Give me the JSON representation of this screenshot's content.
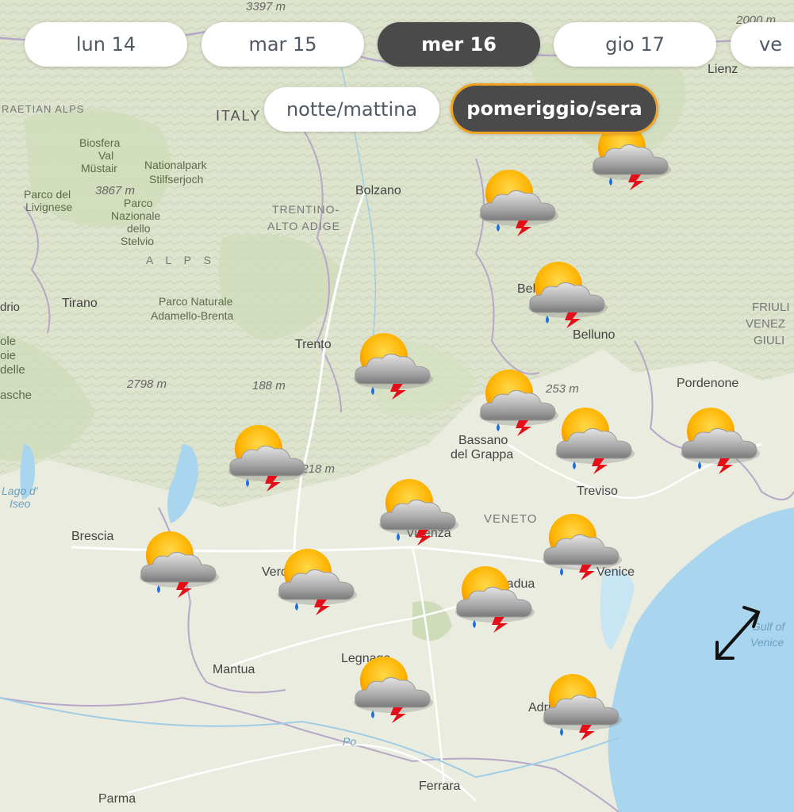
{
  "days": [
    {
      "label": "lun 14",
      "active": false
    },
    {
      "label": "mar 15",
      "active": false
    },
    {
      "label": "mer 16",
      "active": true
    },
    {
      "label": "gio 17",
      "active": false
    },
    {
      "label": "ve",
      "active": false
    }
  ],
  "periods": [
    {
      "label": "notte/mattina",
      "active": false
    },
    {
      "label": "pomeriggio/sera",
      "active": true
    }
  ],
  "map": {
    "places": [
      "Bolzano",
      "TRENTINO-",
      "ALTO ADIGE",
      "Tirano",
      "Trento",
      "Belluno",
      "Pordenone",
      "Bassano",
      "del Grappa",
      "Treviso",
      "VENETO",
      "Vicenza",
      "Brescia",
      "Venice",
      "Padua",
      "Mantua",
      "Legnago",
      "Parma",
      "Ferrara",
      "FRIULI",
      "VENEZ",
      "GIULI",
      "Lienz",
      "ITALY",
      "Adria",
      "Verona",
      "Belluno"
    ],
    "parks": [
      "Biosfera",
      "Val",
      "Müstair",
      "Nationalpark",
      "Stilfserjoch",
      "Parco del",
      "Livignese",
      "Parco",
      "Nazionale",
      "dello",
      "Stelvio",
      "Parco Naturale",
      "Adamello-Brenta",
      "A L P S",
      "RAETIAN ALPS",
      "Lago d'",
      "Iseo",
      "Gulf of",
      "Venice",
      "Po"
    ],
    "elevations": [
      "3397 m",
      "3867 m",
      "2798 m",
      "188 m",
      "2218 m",
      "253 m",
      "2000 m"
    ],
    "left_edge": [
      "drio",
      "ole",
      "oie",
      "delle",
      "asche"
    ],
    "weather_icon": "sun-cloud-rain-lightning-icon",
    "expand_icon": "expand-arrows-icon"
  },
  "colors": {
    "sea": "#a9d6ee",
    "land": "#e9ecdf",
    "forest": "#cfdcb9",
    "accent": "#f0a322",
    "active_pill": "#4a4a4a",
    "sun": "#ffb800"
  }
}
